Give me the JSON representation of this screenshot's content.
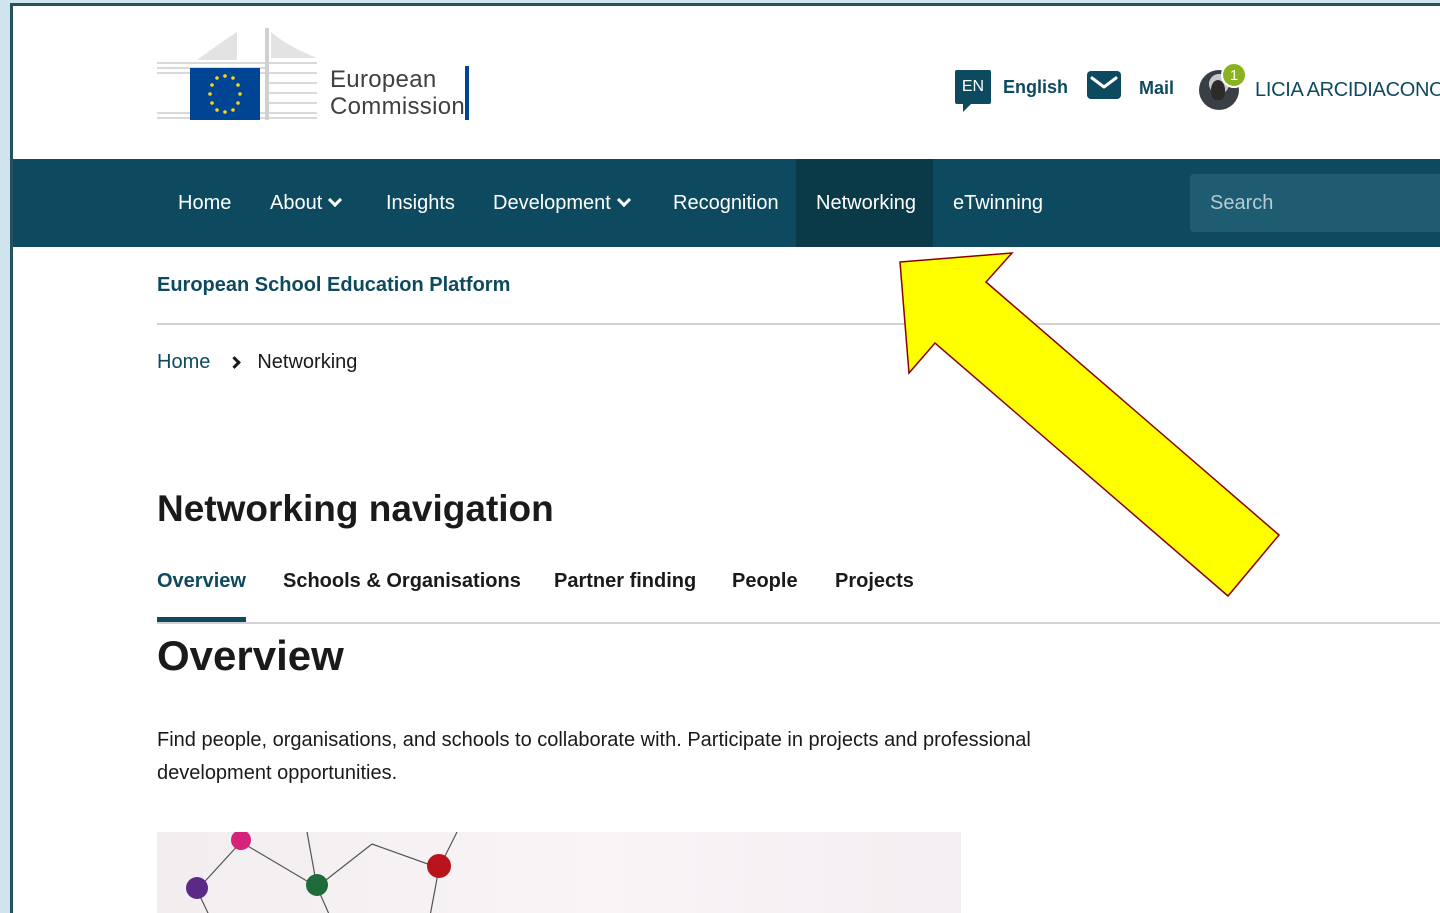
{
  "header": {
    "logo_text_line1": "European",
    "logo_text_line2": "Commission",
    "language_code": "EN",
    "language_label": "English",
    "mail_label": "Mail",
    "notification_count": "1",
    "user_name": "LICIA ARCIDIACONO"
  },
  "navbar": {
    "items": [
      {
        "label": "Home"
      },
      {
        "label": "About"
      },
      {
        "label": "Insights"
      },
      {
        "label": "Development"
      },
      {
        "label": "Recognition"
      },
      {
        "label": "Networking"
      },
      {
        "label": "eTwinning"
      }
    ],
    "search_placeholder": "Search"
  },
  "platform_title": "European School Education Platform",
  "breadcrumb": {
    "home": "Home",
    "current": "Networking"
  },
  "networking_navigation": {
    "heading": "Networking navigation",
    "tabs": [
      {
        "label": "Overview"
      },
      {
        "label": "Schools & Organisations"
      },
      {
        "label": "Partner finding"
      },
      {
        "label": "People"
      },
      {
        "label": "Projects"
      }
    ]
  },
  "overview": {
    "title": "Overview",
    "text": "Find people, organisations, and schools to collaborate with. Participate in projects and professional development opportunities."
  },
  "colors": {
    "brand_dark": "#0e4a5f",
    "annotation_fill": "#ffff00",
    "annotation_stroke": "#8b0000"
  }
}
